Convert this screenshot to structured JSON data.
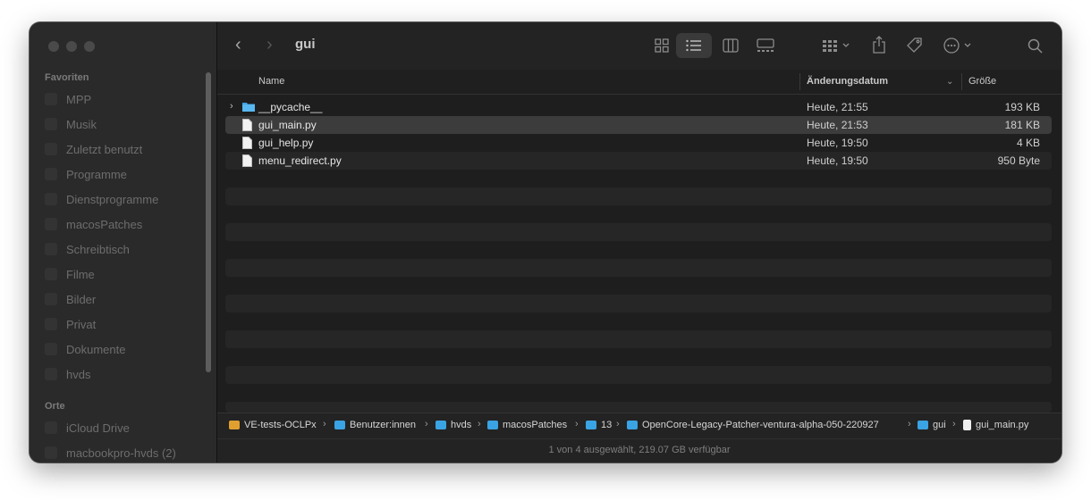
{
  "sidebar": {
    "favorites_heading": "Favoriten",
    "favorites": [
      {
        "label": "MPP",
        "icon": "folder-icon"
      },
      {
        "label": "Musik",
        "icon": "music-icon"
      },
      {
        "label": "Zuletzt benutzt",
        "icon": "clock-icon"
      },
      {
        "label": "Programme",
        "icon": "apps-icon"
      },
      {
        "label": "Dienstprogramme",
        "icon": "tools-icon"
      },
      {
        "label": "macosPatches",
        "icon": "folder-icon"
      },
      {
        "label": "Schreibtisch",
        "icon": "desktop-icon"
      },
      {
        "label": "Filme",
        "icon": "film-icon"
      },
      {
        "label": "Bilder",
        "icon": "photo-icon"
      },
      {
        "label": "Privat",
        "icon": "home-icon"
      },
      {
        "label": "Dokumente",
        "icon": "doc-icon"
      },
      {
        "label": "hvds",
        "icon": "folder-icon"
      }
    ],
    "places_heading": "Orte",
    "places": [
      {
        "label": "iCloud Drive",
        "icon": "cloud-icon"
      },
      {
        "label": "macbookpro-hvds (2)",
        "icon": "computer-icon"
      }
    ]
  },
  "toolbar": {
    "title": "gui"
  },
  "columns": {
    "name": "Name",
    "date": "Änderungsdatum",
    "size": "Größe"
  },
  "files": [
    {
      "name": "__pycache__",
      "date": "Heute, 21:55",
      "size": "193 KB",
      "type": "folder"
    },
    {
      "name": "gui_main.py",
      "date": "Heute, 21:53",
      "size": "181 KB",
      "type": "file"
    },
    {
      "name": "gui_help.py",
      "date": "Heute, 19:50",
      "size": "4 KB",
      "type": "file"
    },
    {
      "name": "menu_redirect.py",
      "date": "Heute, 19:50",
      "size": "950 Byte",
      "type": "file"
    }
  ],
  "path": [
    {
      "label": "VE-tests-OCLPx",
      "icon": "drive-icon"
    },
    {
      "label": "Benutzer:innen",
      "icon": "folder-icon"
    },
    {
      "label": "hvds",
      "icon": "home-folder-icon"
    },
    {
      "label": "macosPatches",
      "icon": "folder-icon"
    },
    {
      "label": "13",
      "icon": "folder-icon"
    },
    {
      "label": "OpenCore-Legacy-Patcher-ventura-alpha-050-220927",
      "icon": "folder-icon"
    },
    {
      "label": "gui",
      "icon": "folder-icon"
    },
    {
      "label": "gui_main.py",
      "icon": "file-icon"
    }
  ],
  "status": "1 von 4 ausgewählt, 219.07 GB verfügbar",
  "colors": {
    "folder": "#3aa3e3",
    "drive": "#e0a030",
    "selection": "#3c3c3c"
  }
}
